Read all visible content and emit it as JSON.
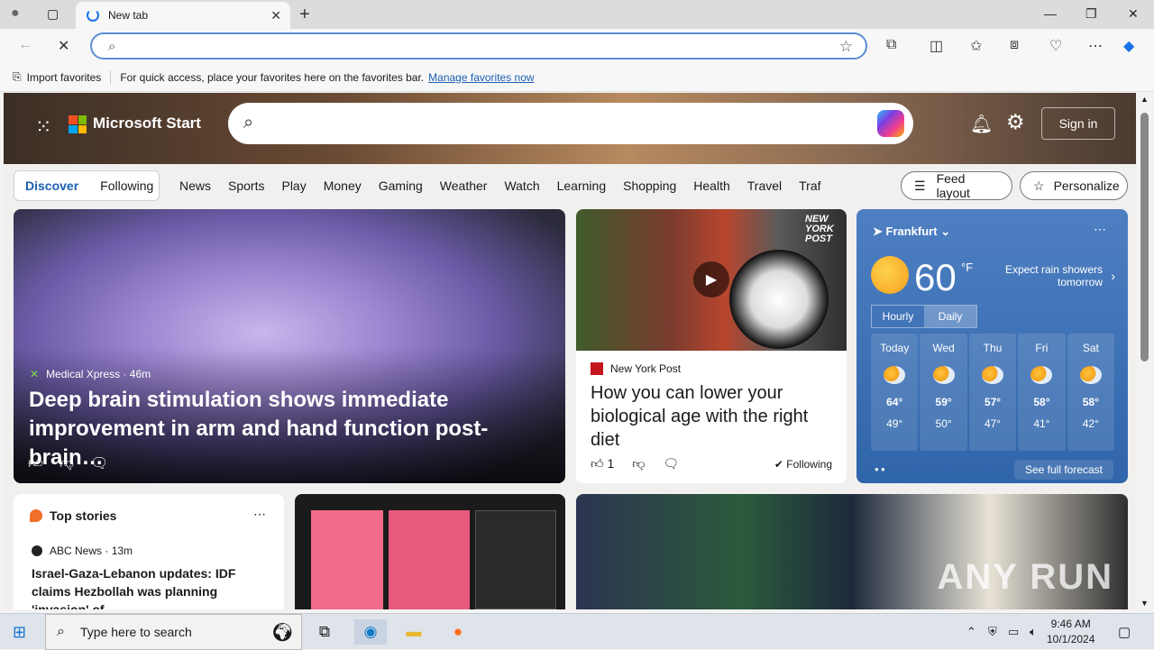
{
  "browser": {
    "tab_title": "New tab",
    "address_value": "",
    "favorites_bar": {
      "import_label": "Import favorites",
      "hint": "For quick access, place your favorites here on the favorites bar.",
      "manage_link": "Manage favorites now"
    }
  },
  "header": {
    "brand": "Microsoft Start",
    "search_value": "",
    "signin_label": "Sign in"
  },
  "nav": {
    "segments": [
      "Discover",
      "Following"
    ],
    "items": [
      "News",
      "Sports",
      "Play",
      "Money",
      "Gaming",
      "Weather",
      "Watch",
      "Learning",
      "Shopping",
      "Health",
      "Travel",
      "Traf"
    ],
    "feed_layout_label": "Feed layout",
    "personalize_label": "Personalize"
  },
  "cards": {
    "main": {
      "source": "Medical Xpress",
      "age": "46m",
      "title": "Deep brain stimulation shows immediate improvement in arm and hand function post-brain…"
    },
    "second": {
      "source": "New York Post",
      "title": "How you can lower your biological age with the right diet",
      "likes": "1",
      "following_label": "Following",
      "logo_text": "NEW YORK POST"
    },
    "top_stories": {
      "header": "Top stories",
      "source": "ABC News",
      "age": "13m",
      "title": "Israel-Gaza-Lebanon updates: IDF claims Hezbollah was planning 'invasion' of…"
    },
    "anime_watermark": "ANY RUN"
  },
  "weather": {
    "location": "Frankfurt",
    "temperature": "60",
    "unit": "°F",
    "forecast": "Expect rain showers tomorrow",
    "tabs": [
      "Hourly",
      "Daily"
    ],
    "days": [
      {
        "name": "Today",
        "hi": "64°",
        "lo": "49°"
      },
      {
        "name": "Wed",
        "hi": "59°",
        "lo": "50°"
      },
      {
        "name": "Thu",
        "hi": "57°",
        "lo": "47°"
      },
      {
        "name": "Fri",
        "hi": "58°",
        "lo": "41°"
      },
      {
        "name": "Sat",
        "hi": "58°",
        "lo": "42°"
      }
    ],
    "see_full": "See full forecast"
  },
  "taskbar": {
    "search_placeholder": "Type here to search",
    "time": "9:46 AM",
    "date": "10/1/2024"
  },
  "colors": {
    "accent": "#1a5fb4",
    "weather_bg": "#3a70b5"
  }
}
